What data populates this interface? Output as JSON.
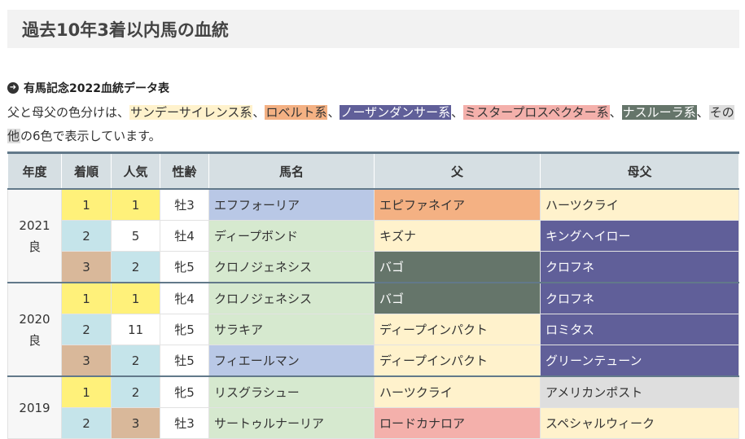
{
  "header": {
    "title": "過去10年3着以内馬の血統"
  },
  "section": {
    "title": "有馬記念2022血統データ表"
  },
  "colors": {
    "sunday": "#fff2cc",
    "roberto": "#f4b183",
    "northern": "#605f99",
    "mrprospector": "#f4b0ab",
    "nasrullah": "#65756a",
    "other": "#dedede",
    "rank1": "#fff17a",
    "rank2": "#c5e4ea",
    "rank3": "#d9b89a",
    "horse_a": "#b9c8e6",
    "horse_b": "#d6e9cf"
  },
  "legend": {
    "prefix": "父と母父の色分けは、",
    "items": [
      {
        "label": "サンデーサイレンス系",
        "color": "sunday",
        "sep": "、"
      },
      {
        "label": "ロベルト系",
        "color": "roberto",
        "sep": "、"
      },
      {
        "label": "ノーザンダンサー系",
        "color": "northern",
        "sep": "、"
      },
      {
        "label": "ミスタープロスペクター系",
        "color": "mrprospector",
        "sep": "、"
      },
      {
        "label": "ナスルーラ系",
        "color": "nasrullah",
        "sep": "、"
      },
      {
        "label": "その他",
        "color": "other",
        "sep": ""
      }
    ],
    "suffix": "の6色で表示しています。"
  },
  "table": {
    "headers": [
      "年度",
      "着順",
      "人気",
      "性齢",
      "馬名",
      "父",
      "母父"
    ],
    "groups": [
      {
        "year": "2021",
        "track": "良",
        "rows": [
          {
            "rank": "1",
            "pop": "1",
            "sexage": "牡3",
            "horse": "エフフォーリア",
            "sire": "エピファネイア",
            "sire_line": "roberto",
            "dam_sire": "ハーツクライ",
            "dam_sire_line": "sunday",
            "horse_bg": "horse_a",
            "pop_bg": "rank1"
          },
          {
            "rank": "2",
            "pop": "5",
            "sexage": "牡4",
            "horse": "ディープボンド",
            "sire": "キズナ",
            "sire_line": "sunday",
            "dam_sire": "キングヘイロー",
            "dam_sire_line": "northern",
            "horse_bg": "horse_b",
            "pop_bg": ""
          },
          {
            "rank": "3",
            "pop": "2",
            "sexage": "牝5",
            "horse": "クロノジェネシス",
            "sire": "バゴ",
            "sire_line": "nasrullah",
            "dam_sire": "クロフネ",
            "dam_sire_line": "northern",
            "horse_bg": "horse_b",
            "pop_bg": "rank2"
          }
        ]
      },
      {
        "year": "2020",
        "track": "良",
        "rows": [
          {
            "rank": "1",
            "pop": "1",
            "sexage": "牝4",
            "horse": "クロノジェネシス",
            "sire": "バゴ",
            "sire_line": "nasrullah",
            "dam_sire": "クロフネ",
            "dam_sire_line": "northern",
            "horse_bg": "horse_b",
            "pop_bg": "rank1"
          },
          {
            "rank": "2",
            "pop": "11",
            "sexage": "牝5",
            "horse": "サラキア",
            "sire": "ディープインパクト",
            "sire_line": "sunday",
            "dam_sire": "ロミタス",
            "dam_sire_line": "northern",
            "horse_bg": "horse_b",
            "pop_bg": ""
          },
          {
            "rank": "3",
            "pop": "2",
            "sexage": "牡5",
            "horse": "フィエールマン",
            "sire": "ディープインパクト",
            "sire_line": "sunday",
            "dam_sire": "グリーンテューン",
            "dam_sire_line": "northern",
            "horse_bg": "horse_a",
            "pop_bg": "rank2"
          }
        ]
      },
      {
        "year": "2019",
        "track": "",
        "rows": [
          {
            "rank": "1",
            "pop": "2",
            "sexage": "牝5",
            "horse": "リスグラシュー",
            "sire": "ハーツクライ",
            "sire_line": "sunday",
            "dam_sire": "アメリカンポスト",
            "dam_sire_line": "other",
            "horse_bg": "horse_b",
            "pop_bg": "rank2"
          },
          {
            "rank": "2",
            "pop": "3",
            "sexage": "牡3",
            "horse": "サートゥルナーリア",
            "sire": "ロードカナロア",
            "sire_line": "mrprospector",
            "dam_sire": "スペシャルウィーク",
            "dam_sire_line": "sunday",
            "horse_bg": "horse_b",
            "pop_bg": "rank3"
          }
        ]
      }
    ]
  }
}
